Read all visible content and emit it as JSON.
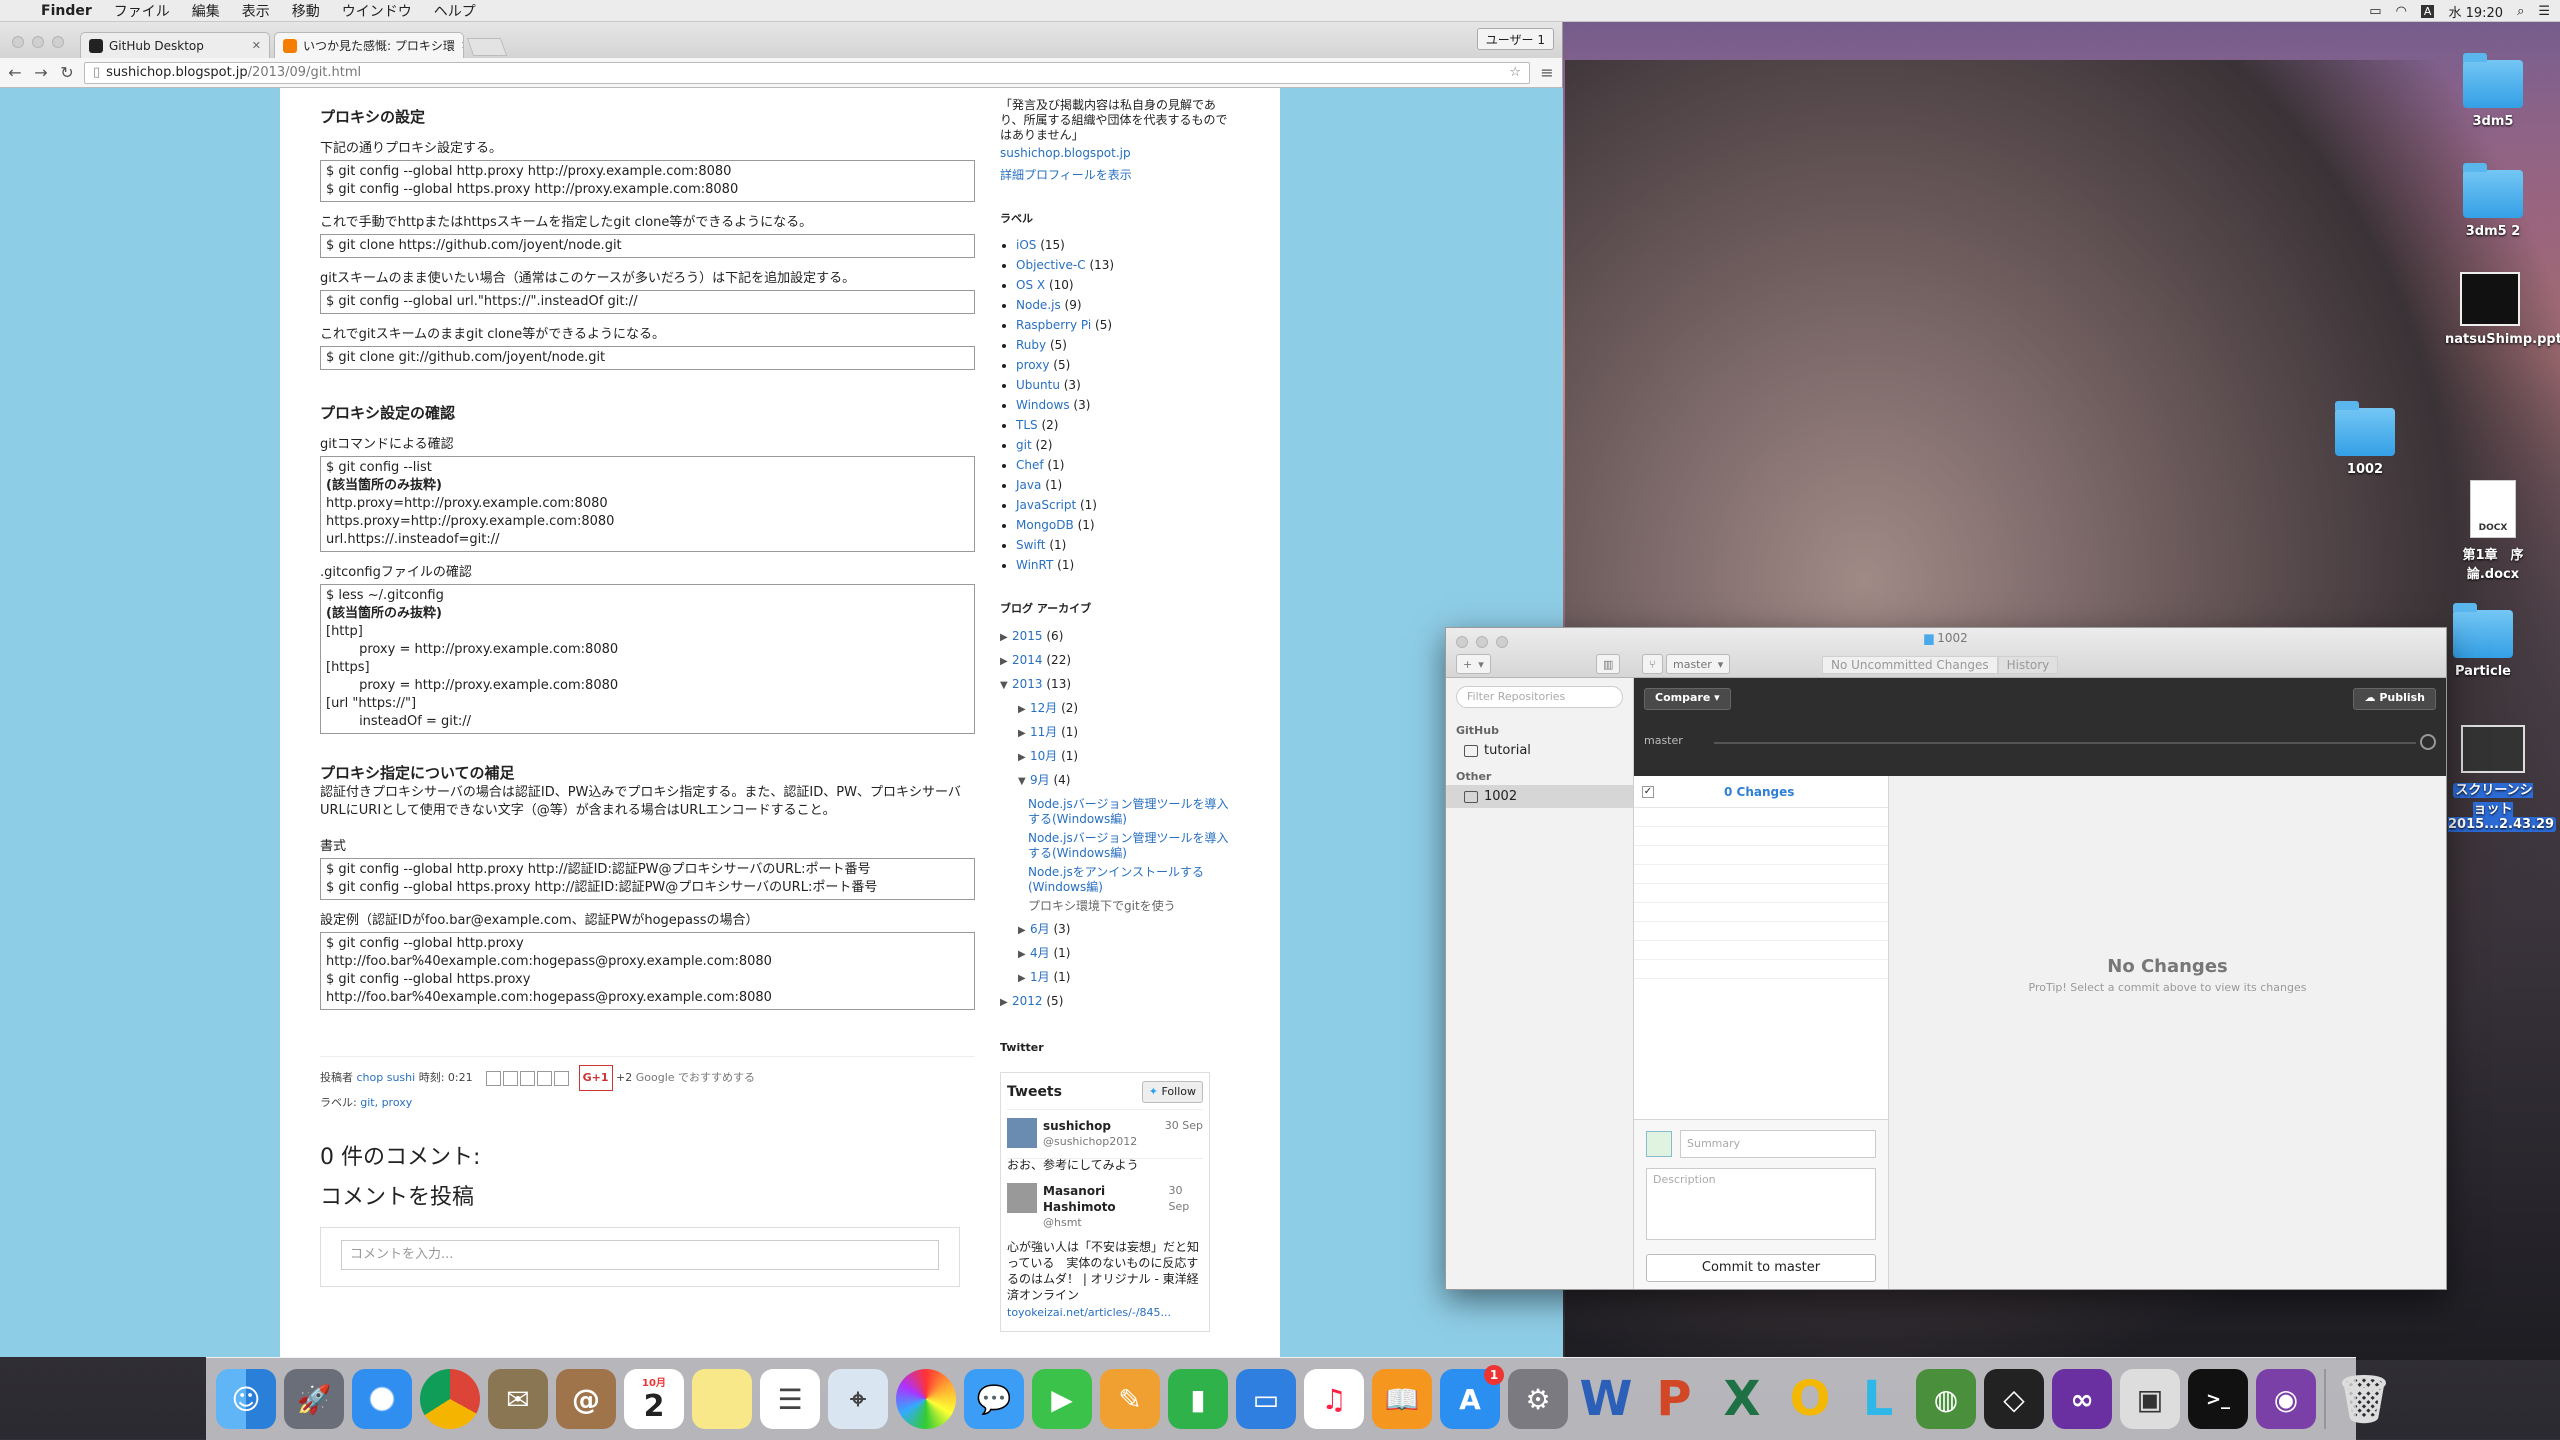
{
  "menubar": {
    "app": "Finder",
    "items": [
      "ファイル",
      "編集",
      "表示",
      "移動",
      "ウインドウ",
      "ヘルプ"
    ],
    "clock": "水 19:20",
    "ime": "A"
  },
  "browser": {
    "tabs": [
      {
        "title": "GitHub Desktop"
      },
      {
        "title": "いつか見た感慨: プロキシ環"
      }
    ],
    "user_button": "ユーザー 1",
    "url_host": "sushichop.blogspot.jp",
    "url_path": "/2013/09/git.html"
  },
  "post": {
    "h_proxy": "プロキシの設定",
    "p1": "下記の通りプロキシ設定する。",
    "code1": "$ git config --global http.proxy http://proxy.example.com:8080\n$ git config --global https.proxy http://proxy.example.com:8080",
    "p2": "これで手動でhttpまたはhttpsスキームを指定したgit clone等ができるようになる。",
    "code2": "$ git clone https://github.com/joyent/node.git",
    "p3": "gitスキームのまま使いたい場合（通常はこのケースが多いだろう）は下記を追加設定する。",
    "code3": "$ git config --global url.\"https://\".insteadOf git://",
    "p4": "これでgitスキームのままgit clone等ができるようになる。",
    "code4": "$ git clone git://github.com/joyent/node.git",
    "h_check": "プロキシ設定の確認",
    "p5": "gitコマンドによる確認",
    "code5a": "$ git config --list",
    "code5b": "(該当箇所のみ抜粋)",
    "code5c": "http.proxy=http://proxy.example.com:8080\nhttps.proxy=http://proxy.example.com:8080\nurl.https://.insteadof=git://",
    "p6": ".gitconfigファイルの確認",
    "code6a": "$ less ~/.gitconfig",
    "code6b": "(該当箇所のみ抜粋)",
    "code6c": "[http]\n        proxy = http://proxy.example.com:8080\n[https]\n        proxy = http://proxy.example.com:8080\n[url \"https://\"]\n        insteadOf = git://",
    "h_note": "プロキシ指定についての補足",
    "p7": "認証付きプロキシサーバの場合は認証ID、PW込みでプロキシ指定する。また、認証ID、PW、プロキシサーバURLにURIとして使用できない文字（@等）が含まれる場合はURLエンコードすること。",
    "p8": "書式",
    "code8": "$ git config --global http.proxy http://認証ID:認証PW@プロキシサーバのURL:ポート番号\n$ git config --global https.proxy http://認証ID:認証PW@プロキシサーバのURL:ポート番号",
    "p9": "設定例（認証IDがfoo.bar@example.com、認証PWがhogepassの場合）",
    "code9": "$ git config --global http.proxy http://foo.bar%40example.com:hogepass@proxy.example.com:8080\n$ git config --global https.proxy\nhttp://foo.bar%40example.com:hogepass@proxy.example.com:8080",
    "foot_author_prefix": "投稿者",
    "foot_author": "chop sushi",
    "foot_time": "時刻: 0:21",
    "foot_plus": "+2",
    "foot_recommend": "Google でおすすめする",
    "foot_labels_prefix": "ラベル:",
    "foot_labels": "git, proxy",
    "gplus": "G+1",
    "comments_count": "0 件のコメント:",
    "comments_post": "コメントを投稿",
    "comment_placeholder": "コメントを入力..."
  },
  "sidebar": {
    "desc": "「発言及び掲載内容は私自身の見解であり、所属する組織や団体を代表するものではありません」",
    "site": "sushichop.blogspot.jp",
    "profile": "詳細プロフィールを表示",
    "labels_h": "ラベル",
    "labels": [
      {
        "name": "iOS",
        "count": "(15)"
      },
      {
        "name": "Objective-C",
        "count": "(13)"
      },
      {
        "name": "OS X",
        "count": "(10)"
      },
      {
        "name": "Node.js",
        "count": "(9)"
      },
      {
        "name": "Raspberry Pi",
        "count": "(5)"
      },
      {
        "name": "Ruby",
        "count": "(5)"
      },
      {
        "name": "proxy",
        "count": "(5)"
      },
      {
        "name": "Ubuntu",
        "count": "(3)"
      },
      {
        "name": "Windows",
        "count": "(3)"
      },
      {
        "name": "TLS",
        "count": "(2)"
      },
      {
        "name": "git",
        "count": "(2)"
      },
      {
        "name": "Chef",
        "count": "(1)"
      },
      {
        "name": "Java",
        "count": "(1)"
      },
      {
        "name": "JavaScript",
        "count": "(1)"
      },
      {
        "name": "MongoDB",
        "count": "(1)"
      },
      {
        "name": "Swift",
        "count": "(1)"
      },
      {
        "name": "WinRT",
        "count": "(1)"
      }
    ],
    "archive_h": "ブログ アーカイブ",
    "archive": {
      "y2015": "2015",
      "y2015c": "(6)",
      "y2014": "2014",
      "y2014c": "(22)",
      "y2013": "2013",
      "y2013c": "(13)",
      "m12": "12月",
      "m12c": "(2)",
      "m11": "11月",
      "m11c": "(1)",
      "m10": "10月",
      "m10c": "(1)",
      "m9": "9月",
      "m9c": "(4)",
      "post1": "Node.jsバージョン管理ツールを導入する(Windows編)",
      "post2": "Node.jsバージョン管理ツールを導入する(Windows編)",
      "post3": "Node.jsをアンインストールする(Windows編)",
      "post4": "プロキシ環境下でgitを使う",
      "m6": "6月",
      "m6c": "(3)",
      "m4": "4月",
      "m4c": "(1)",
      "m1": "1月",
      "m1c": "(1)",
      "y2012": "2012",
      "y2012c": "(5)"
    },
    "twitter_h": "Twitter",
    "tweets_title": "Tweets",
    "follow": "Follow",
    "tweets": [
      {
        "name": "sushichop",
        "handle": "@sushichop2012",
        "date": "30 Sep",
        "text": "おお、参考にしてみよう"
      },
      {
        "name": "Masanori Hashimoto",
        "handle": "@hsmt",
        "date": "30 Sep",
        "text": "心が強い人は「不安は妄想」だと知っている　実体のないものに反応するのはムダ！ | オリジナル - 東洋経済オンライン",
        "link": "toyokeizai.net/articles/-/845..."
      }
    ]
  },
  "desktop": {
    "icons": [
      {
        "label": "3dm5"
      },
      {
        "label": "3dm5 2"
      },
      {
        "label": "natsuShimp.pptx"
      },
      {
        "label": "1002"
      },
      {
        "label": "第1章　序論.docx"
      },
      {
        "label": "Particle"
      },
      {
        "label": "スクリーンショット 2015...2.43.29"
      }
    ],
    "docx_tag": "DOCX"
  },
  "github": {
    "window_title": "1002",
    "branch": "master",
    "seg_changes": "No Uncommitted Changes",
    "seg_history": "History",
    "filter_placeholder": "Filter Repositories",
    "group_github": "GitHub",
    "repo_tutorial": "tutorial",
    "group_other": "Other",
    "repo_1002": "1002",
    "compare": "Compare ▾",
    "publish": "Publish",
    "branch_label": "master",
    "changes": "0 Changes",
    "summary_placeholder": "Summary",
    "description_placeholder": "Description",
    "commit_button": "Commit to master",
    "no_changes": "No Changes",
    "protip": "ProTip! Select a commit above to view its changes"
  },
  "dock": {
    "calendar_month": "10月",
    "calendar_day": "2",
    "badge": "1"
  },
  "colors": {
    "link": "#2870c0",
    "blog_bg": "#8ecde6",
    "gh_accent": "#2f7fd6"
  }
}
